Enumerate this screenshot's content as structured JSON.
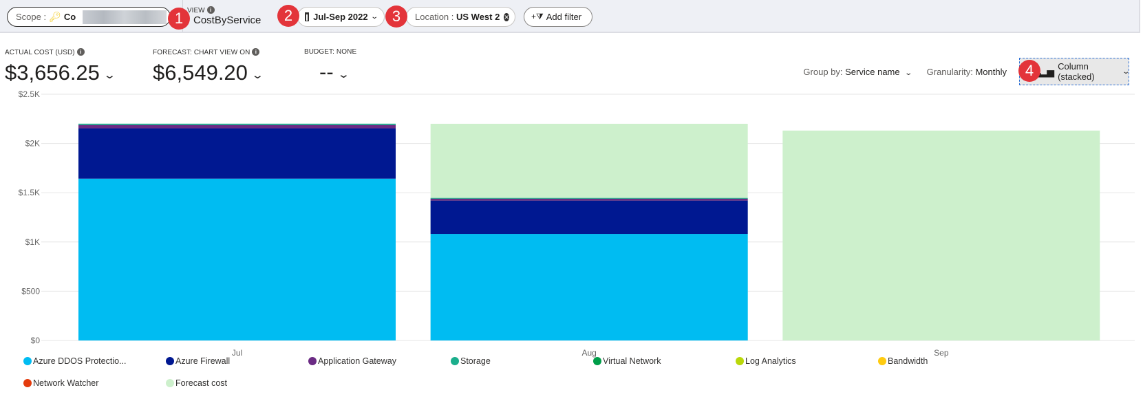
{
  "toolbar": {
    "scope_label": "Scope :",
    "scope_value": "Co",
    "view_label": "VIEW",
    "view_name": "CostByService",
    "date_range": "Jul-Sep 2022",
    "location_label": "Location :",
    "location_value": "US West 2",
    "add_filter": "Add filter"
  },
  "badges": [
    "1",
    "2",
    "3",
    "4"
  ],
  "kpis": {
    "actual_label": "ACTUAL COST (USD)",
    "actual_value": "$3,656.25",
    "forecast_label": "FORECAST: CHART VIEW ON",
    "forecast_value": "$6,549.20",
    "budget_label": "BUDGET: NONE",
    "budget_value": "--"
  },
  "controls": {
    "group_by_label": "Group by:",
    "group_by_value": "Service name",
    "granularity_label": "Granularity:",
    "granularity_value": "Monthly",
    "chart_type": "Column (stacked)"
  },
  "colors": {
    "Azure DDOS Protectio...": "#00bcf2",
    "Azure Firewall": "#001891",
    "Application Gateway": "#6b2b84",
    "Storage": "#1bae8c",
    "Virtual Network": "#009e49",
    "Log Analytics": "#bad80a",
    "Bandwidth": "#ffcb10",
    "Network Watcher": "#e43b0d",
    "Forecast cost": "#cdf0cc"
  },
  "chart_data": {
    "type": "bar",
    "stacked": true,
    "categories": [
      "Jul",
      "Aug",
      "Sep"
    ],
    "ylim": [
      0,
      2500
    ],
    "yticks": [
      0,
      500,
      1000,
      1500,
      2000,
      2500
    ],
    "ytick_labels": [
      "$0",
      "$500",
      "$1K",
      "$1.5K",
      "$2K",
      "$2.5K"
    ],
    "grid": true,
    "legend_position": "bottom",
    "series": [
      {
        "name": "Azure DDOS Protectio...",
        "values": [
          1643,
          1082,
          0
        ]
      },
      {
        "name": "Azure Firewall",
        "values": [
          511,
          338,
          0
        ]
      },
      {
        "name": "Application Gateway",
        "values": [
          34,
          20,
          0
        ]
      },
      {
        "name": "Storage",
        "values": [
          13,
          7,
          0
        ]
      },
      {
        "name": "Virtual Network",
        "values": [
          0,
          0,
          0
        ]
      },
      {
        "name": "Log Analytics",
        "values": [
          0,
          0,
          0
        ]
      },
      {
        "name": "Bandwidth",
        "values": [
          0,
          0,
          0
        ]
      },
      {
        "name": "Network Watcher",
        "values": [
          0,
          0,
          0
        ]
      }
    ],
    "forecast": {
      "name": "Forecast cost",
      "values": [
        null,
        2200,
        2131
      ]
    }
  }
}
